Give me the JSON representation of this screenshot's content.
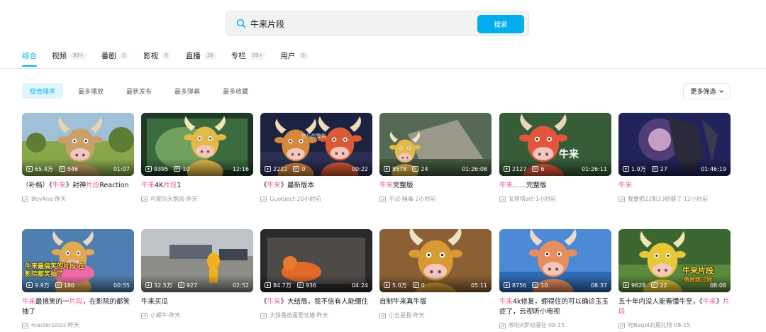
{
  "search": {
    "query": "牛来片段",
    "button_label": "搜索"
  },
  "tabs": [
    {
      "label": "综合",
      "count": ""
    },
    {
      "label": "视频",
      "count": "99+"
    },
    {
      "label": "番剧",
      "count": "0"
    },
    {
      "label": "影视",
      "count": "0"
    },
    {
      "label": "直播",
      "count": "26"
    },
    {
      "label": "专栏",
      "count": "99+"
    },
    {
      "label": "用户",
      "count": "0"
    }
  ],
  "sorts": [
    "综合排序",
    "最多播放",
    "最新发布",
    "最多弹幕",
    "最多收藏"
  ],
  "more_filter_label": "更多筛选",
  "colors": {
    "accent": "#00aeec",
    "highlight": "#f25d8e"
  },
  "videos": [
    {
      "views": "65.4万",
      "danmaku": "546",
      "duration": "01:07",
      "title_parts": [
        "（补档）《",
        "牛来",
        "》封神",
        "片段",
        "Reaction"
      ],
      "uploader": "BbyAne",
      "time": "昨天"
    },
    {
      "views": "9395",
      "danmaku": "10",
      "duration": "12:16",
      "title_parts": [
        "",
        "牛来",
        "4K",
        "片段",
        "1"
      ],
      "uploader": "可爱的天鹅肉",
      "time": "昨天"
    },
    {
      "views": "2222",
      "danmaku": "0",
      "duration": "00:22",
      "title_parts": [
        "《",
        "牛来",
        "》最新版本"
      ],
      "uploader": "Guobject",
      "time": "20小时前",
      "overlay": "伤后的警告"
    },
    {
      "views": "8578",
      "danmaku": "24",
      "duration": "01:26:08",
      "title_parts": [
        "",
        "牛来",
        "完整版"
      ],
      "uploader": "不沾-赌毒",
      "time": "2小时前"
    },
    {
      "views": "2127",
      "danmaku": "6",
      "duration": "01:26:11",
      "title_parts": [
        "",
        "牛来",
        "……完整版"
      ],
      "uploader": "安塔塔att",
      "time": "1小时前",
      "overlay": "牛来"
    },
    {
      "views": "1.9万",
      "danmaku": "27",
      "duration": "01:46:19",
      "title_parts": [
        "",
        "牛来"
      ],
      "uploader": "我要把22和33给娶了",
      "time": "12小时前"
    },
    {
      "views": "9.9万",
      "danmaku": "180",
      "duration": "00:55",
      "title_parts": [
        "",
        "牛来",
        "最搞笑的一",
        "片段",
        "，在影院的都笑抽了"
      ],
      "uploader": "masterzzzzz",
      "time": "昨天",
      "overlay": "牛来最搞笑的片段 在影院都笑抽了"
    },
    {
      "views": "32.5万",
      "danmaku": "927",
      "duration": "02:52",
      "title_parts": [
        "牛来买瓜"
      ],
      "uploader": "小颠牛",
      "time": "昨天"
    },
    {
      "views": "84.7万",
      "danmaku": "936",
      "duration": "04:24",
      "title_parts": [
        "《",
        "牛来",
        "》大结局，我不信有人能绷住"
      ],
      "uploader": "大饼番茄蛋爱吐槽",
      "time": "昨天"
    },
    {
      "views": "5.0万",
      "danmaku": "0",
      "duration": "05:11",
      "title_parts": [
        "自制牛来真牛版"
      ],
      "uploader": "小五是我",
      "time": "昨天"
    },
    {
      "views": "8756",
      "danmaku": "10",
      "duration": "08:37",
      "title_parts": [
        "",
        "牛来",
        "4k修复，绷得住的可以确诊玉玉症了，云视听小电视"
      ],
      "uploader": "哆啦A梦动漫社",
      "time": "08-15"
    },
    {
      "views": "9628",
      "danmaku": "22",
      "duration": "08:08",
      "title_parts": [
        "五十年内没人能看懂牛至，《",
        "牛来",
        "》",
        "片段"
      ],
      "uploader": "吃Bagel的莫扎特",
      "time": "08-15",
      "overlay": "牛来片段",
      "overlay2": "勇敢跳过她"
    }
  ]
}
